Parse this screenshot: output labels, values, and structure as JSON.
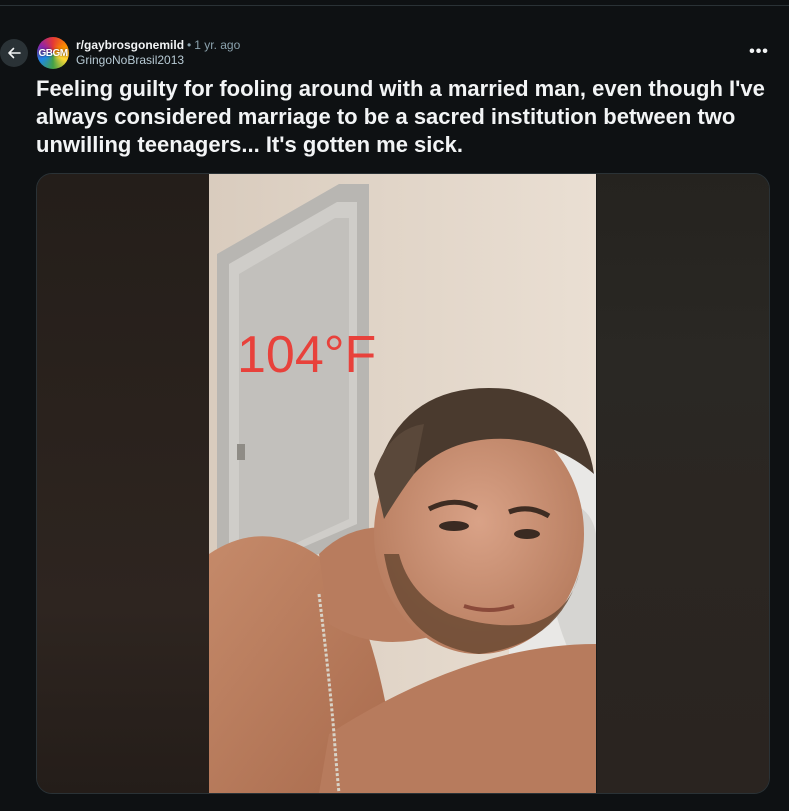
{
  "post": {
    "subreddit": "r/gaybrosgonemild",
    "separator": "•",
    "time_ago": "1 yr. ago",
    "author": "GringoNoBrasil2013",
    "avatar_text": "GBGM",
    "more_label": "•••",
    "title": "Feeling guilty for fooling around with a married man, even though I've always considered marriage to be a sacred institution between two unwilling teenagers... It's gotten me sick."
  },
  "media": {
    "overlay_text": "104°F",
    "overlay_color": "#e8413b"
  },
  "icons": {
    "back": "arrow-left-icon",
    "more": "more-horizontal-icon"
  },
  "colors": {
    "background": "#0e1113",
    "text_primary": "#f2f4f5",
    "text_secondary": "#8ba2ad",
    "button_bg": "#2a3236"
  }
}
